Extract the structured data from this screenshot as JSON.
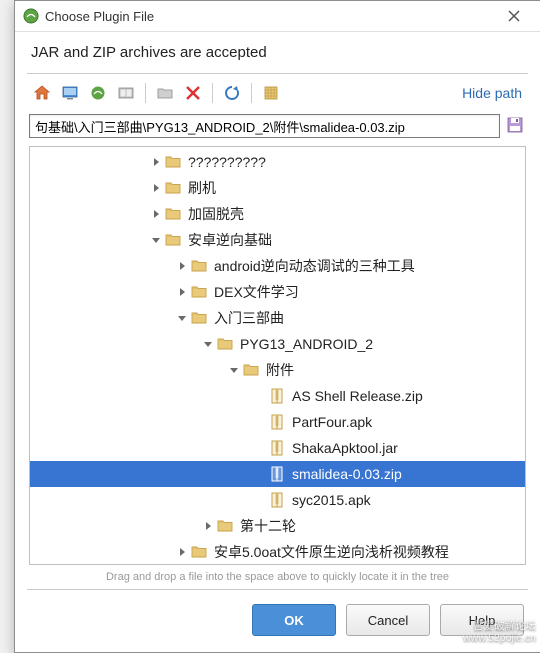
{
  "window": {
    "title": "Choose Plugin File"
  },
  "subtitle": "JAR and ZIP archives are accepted",
  "hide_path": "Hide path",
  "path_value": "句基础\\入门三部曲\\PYG13_ANDROID_2\\附件\\smalidea-0.03.zip",
  "hint": "Drag and drop a file into the space above to quickly locate it in the tree",
  "buttons": {
    "ok": "OK",
    "cancel": "Cancel",
    "help": "Help"
  },
  "watermark": {
    "line1": "吾爱破解论坛",
    "line2": "www.52pojie.cn"
  },
  "icons": {
    "home": "home-icon",
    "desktop": "desktop-icon",
    "project": "project-icon",
    "newfolder": "new-folder-icon",
    "module": "module-icon",
    "delete": "delete-icon",
    "refresh": "refresh-icon",
    "showhidden": "show-hidden-icon",
    "save": "save-icon",
    "app": "app-icon",
    "close": "close-icon"
  },
  "tree": [
    {
      "depth": 3,
      "expander": "right",
      "icon": "folder",
      "label": "??????????",
      "selected": false
    },
    {
      "depth": 3,
      "expander": "right",
      "icon": "folder",
      "label": "刷机",
      "selected": false
    },
    {
      "depth": 3,
      "expander": "right",
      "icon": "folder",
      "label": "加固脱壳",
      "selected": false
    },
    {
      "depth": 3,
      "expander": "down",
      "icon": "folder",
      "label": "安卓逆向基础",
      "selected": false
    },
    {
      "depth": 4,
      "expander": "right",
      "icon": "folder",
      "label": "android逆向动态调试的三种工具",
      "selected": false
    },
    {
      "depth": 4,
      "expander": "right",
      "icon": "folder",
      "label": "DEX文件学习",
      "selected": false
    },
    {
      "depth": 4,
      "expander": "down",
      "icon": "folder",
      "label": "入门三部曲",
      "selected": false
    },
    {
      "depth": 5,
      "expander": "down",
      "icon": "folder",
      "label": "PYG13_ANDROID_2",
      "selected": false
    },
    {
      "depth": 6,
      "expander": "down",
      "icon": "folder",
      "label": "附件",
      "selected": false
    },
    {
      "depth": 7,
      "expander": "none",
      "icon": "zip",
      "label": "AS Shell Release.zip",
      "selected": false
    },
    {
      "depth": 7,
      "expander": "none",
      "icon": "apk",
      "label": "PartFour.apk",
      "selected": false
    },
    {
      "depth": 7,
      "expander": "none",
      "icon": "jar",
      "label": "ShakaApktool.jar",
      "selected": false
    },
    {
      "depth": 7,
      "expander": "none",
      "icon": "zip",
      "label": "smalidea-0.03.zip",
      "selected": true
    },
    {
      "depth": 7,
      "expander": "none",
      "icon": "apk",
      "label": "syc2015.apk",
      "selected": false
    },
    {
      "depth": 5,
      "expander": "right",
      "icon": "folder",
      "label": "第十二轮",
      "selected": false
    },
    {
      "depth": 4,
      "expander": "right",
      "icon": "folder",
      "label": "安卓5.0oat文件原生逆向浅析视频教程",
      "selected": false
    }
  ]
}
